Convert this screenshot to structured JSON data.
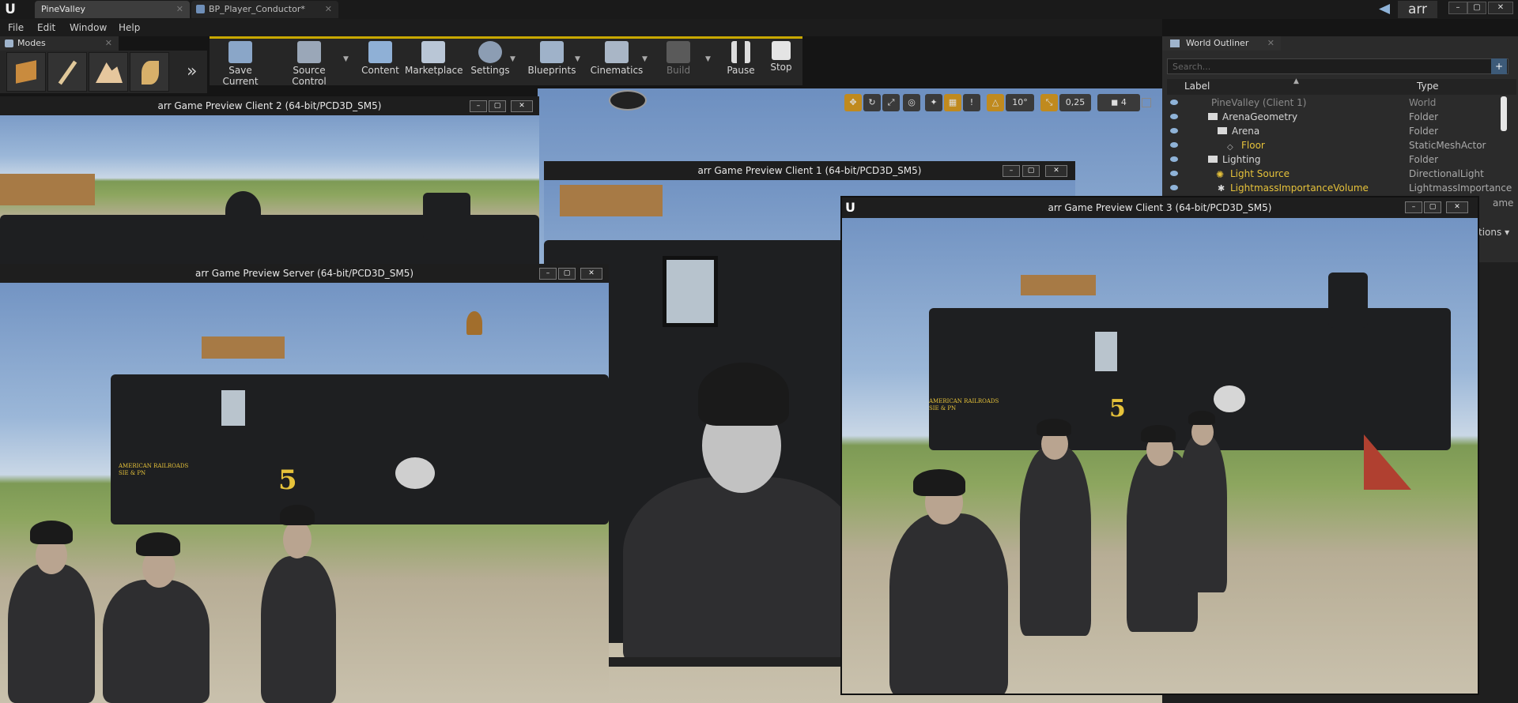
{
  "titlebar": {
    "tabs": [
      {
        "label": "PineValley"
      },
      {
        "label": "BP_Player_Conductor*"
      }
    ],
    "project_name": "arr"
  },
  "menu": [
    "File",
    "Edit",
    "Window",
    "Help"
  ],
  "modes": {
    "title": "Modes",
    "more": "»"
  },
  "toolbar": {
    "buttons": [
      {
        "label": "Save Current"
      },
      {
        "label": "Source Control"
      },
      {
        "label": "Content"
      },
      {
        "label": "Marketplace"
      },
      {
        "label": "Settings"
      },
      {
        "label": "Blueprints"
      },
      {
        "label": "Cinematics"
      },
      {
        "label": "Build"
      },
      {
        "label": "Pause"
      },
      {
        "label": "Stop"
      }
    ]
  },
  "viewport_toolbar": {
    "rotation_snap": "10°",
    "scale_snap": "0,25",
    "camera_speed": "4"
  },
  "outliner": {
    "title": "World Outliner",
    "search_placeholder": "Search...",
    "col_label": "Label",
    "col_type": "Type",
    "rows": [
      {
        "label": "PineValley (Client 1)",
        "type": "World"
      },
      {
        "label": "ArenaGeometry",
        "type": "Folder"
      },
      {
        "label": "Arena",
        "type": "Folder"
      },
      {
        "label": "Floor",
        "type": "StaticMeshActor"
      },
      {
        "label": "Lighting",
        "type": "Folder"
      },
      {
        "label": "Light Source",
        "type": "DirectionalLight"
      },
      {
        "label": "LightmassImportanceVolume",
        "type": "LightmassImportance"
      }
    ],
    "partial_type": "ame",
    "view_options": "tions"
  },
  "windows": {
    "client2": "arr Game Preview Client 2 (64-bit/PCD3D_SM5)",
    "client1": "arr Game Preview Client 1 (64-bit/PCD3D_SM5)",
    "server": "arr Game Preview Server (64-bit/PCD3D_SM5)",
    "client3": "arr Game Preview Client 3 (64-bit/PCD3D_SM5)"
  },
  "scene": {
    "loco_number": "5",
    "loco_lettering": "AMERICAN RAILROADS SIE & PN"
  },
  "colors": {
    "accent": "#c8a800",
    "folder_text": "#c8c8c8",
    "actor_text": "#e6c23a"
  }
}
